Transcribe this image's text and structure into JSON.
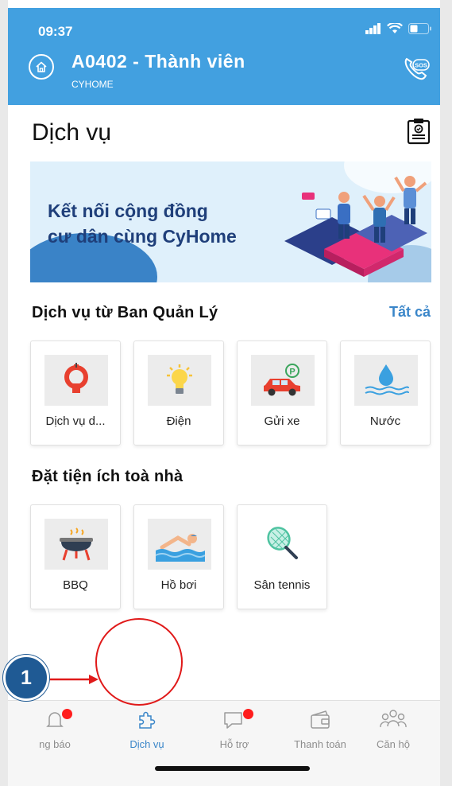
{
  "status_bar": {
    "time": "09:37"
  },
  "header": {
    "title": "A0402 - Thành viên",
    "subtitle": "CYHOME"
  },
  "page": {
    "title": "Dịch vụ"
  },
  "banner": {
    "line1": "Kết nối cộng đồng",
    "line2": "cư dân cùng CyHome"
  },
  "management_services": {
    "title": "Dịch vụ từ Ban Quản Lý",
    "see_all": "Tất cả",
    "items": [
      {
        "label": "Dịch vụ d...",
        "icon": "hose-icon"
      },
      {
        "label": "Điện",
        "icon": "lightbulb-icon"
      },
      {
        "label": "Gửi xe",
        "icon": "car-parking-icon"
      },
      {
        "label": "Nước",
        "icon": "water-drop-icon"
      }
    ]
  },
  "facilities": {
    "title": "Đặt tiện ích toà nhà",
    "items": [
      {
        "label": "BBQ",
        "icon": "bbq-grill-icon"
      },
      {
        "label": "Hồ bơi",
        "icon": "swimmer-icon"
      },
      {
        "label": "Sân tennis",
        "icon": "tennis-racket-icon"
      }
    ]
  },
  "bottom_nav": {
    "items": [
      {
        "label": "ng báo"
      },
      {
        "label": "Dịch vụ"
      },
      {
        "label": "Hỗ trợ"
      },
      {
        "label": "Thanh toán"
      },
      {
        "label": "Căn hộ"
      }
    ]
  },
  "annotation": {
    "step": "1"
  },
  "colors": {
    "header": "#42a0e0",
    "accent": "#3a86c9",
    "badge": "#ff1d1d",
    "callout": "#1f5a94",
    "callout_ring": "#e01a1a"
  }
}
